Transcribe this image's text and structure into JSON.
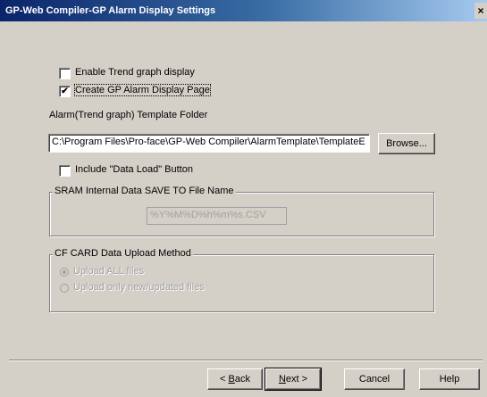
{
  "window": {
    "title": "GP-Web Compiler-GP Alarm Display Settings",
    "close_glyph": "×"
  },
  "options": {
    "enable_trend": {
      "label": "Enable Trend graph display",
      "checked": false
    },
    "create_alarm_page": {
      "label": "Create GP Alarm Display Page",
      "checked": true
    },
    "include_data_load": {
      "label": "Include \"Data Load\" Button",
      "checked": false
    }
  },
  "template_folder": {
    "label": "Alarm(Trend graph) Template Folder",
    "path": "C:\\Program Files\\Pro-face\\GP-Web Compiler\\AlarmTemplate\\TemplateE",
    "browse_label": "Browse..."
  },
  "sram_group": {
    "legend": "SRAM Internal Data SAVE TO File Name",
    "filename": "%Y%M%D%h%m%s.CSV"
  },
  "cf_group": {
    "legend": "CF CARD Data Upload Method",
    "upload_all": {
      "label": "Upload ALL files",
      "selected": true
    },
    "upload_new": {
      "label": "Upload only new/updated files",
      "selected": false
    }
  },
  "buttons": {
    "back_prefix": "< ",
    "back_key": "B",
    "back_rest": "ack",
    "next_key": "N",
    "next_rest": "ext >",
    "cancel": "Cancel",
    "help": "Help"
  },
  "check_glyph": "✔"
}
